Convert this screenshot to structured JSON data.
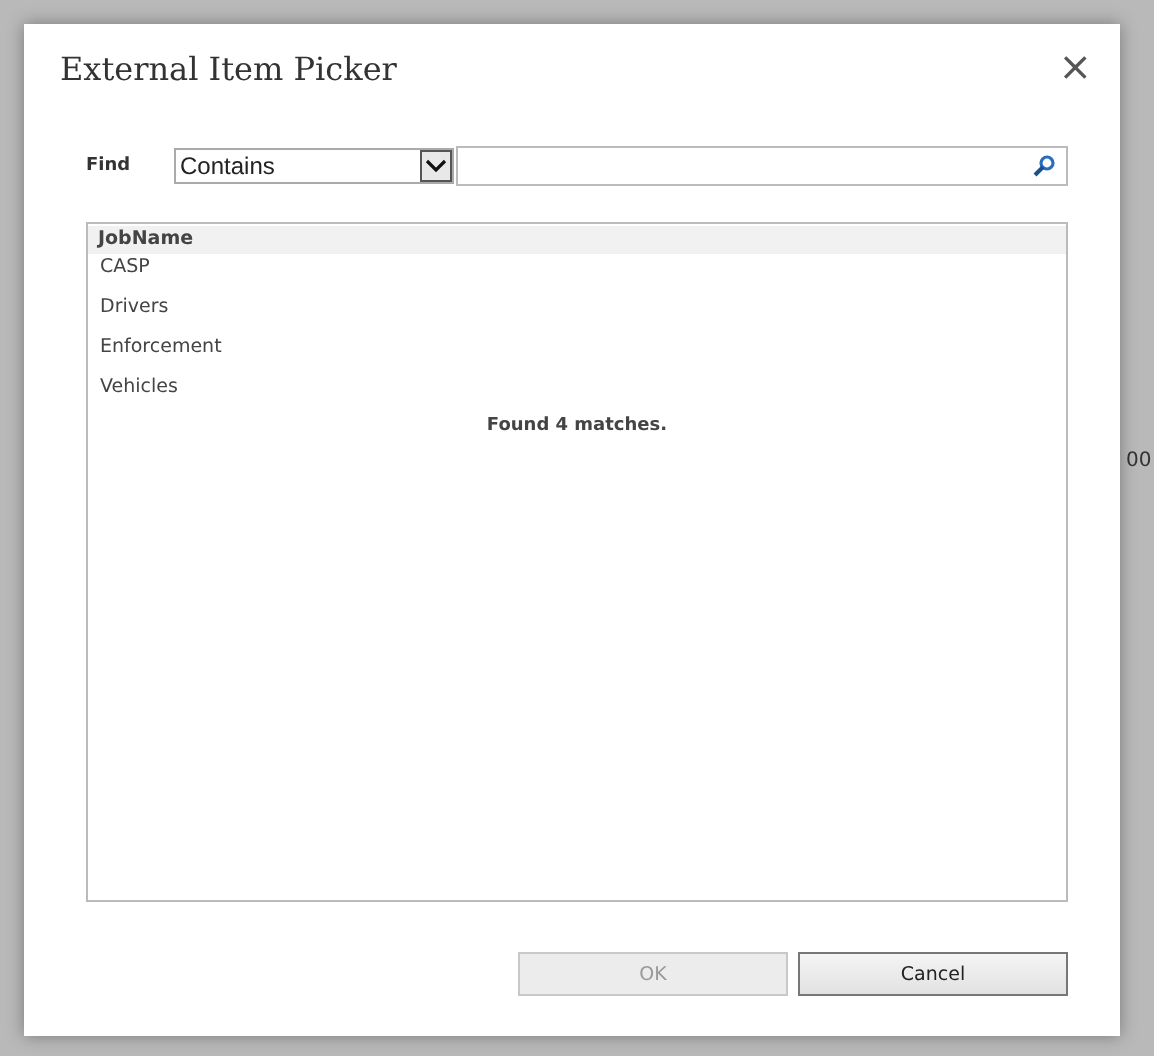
{
  "window": {
    "title": "External Item Picker",
    "close": "×"
  },
  "find": {
    "label": "Find",
    "mode": "Contains"
  },
  "table": {
    "columns": [
      "JobName"
    ],
    "rows": [
      {
        "cells": [
          "CASP"
        ],
        "selected": false
      },
      {
        "cells": [
          "Drivers"
        ],
        "selected": false
      },
      {
        "cells": [
          "Enforcement"
        ],
        "selected": false
      },
      {
        "cells": [
          "Vehicles"
        ],
        "selected": false
      }
    ],
    "status": "Found 4 matches."
  },
  "buttons": [
    {
      "label": "OK",
      "disabled": true
    },
    {
      "label": "Cancel",
      "disabled": false
    }
  ],
  "background_fragment": "00"
}
